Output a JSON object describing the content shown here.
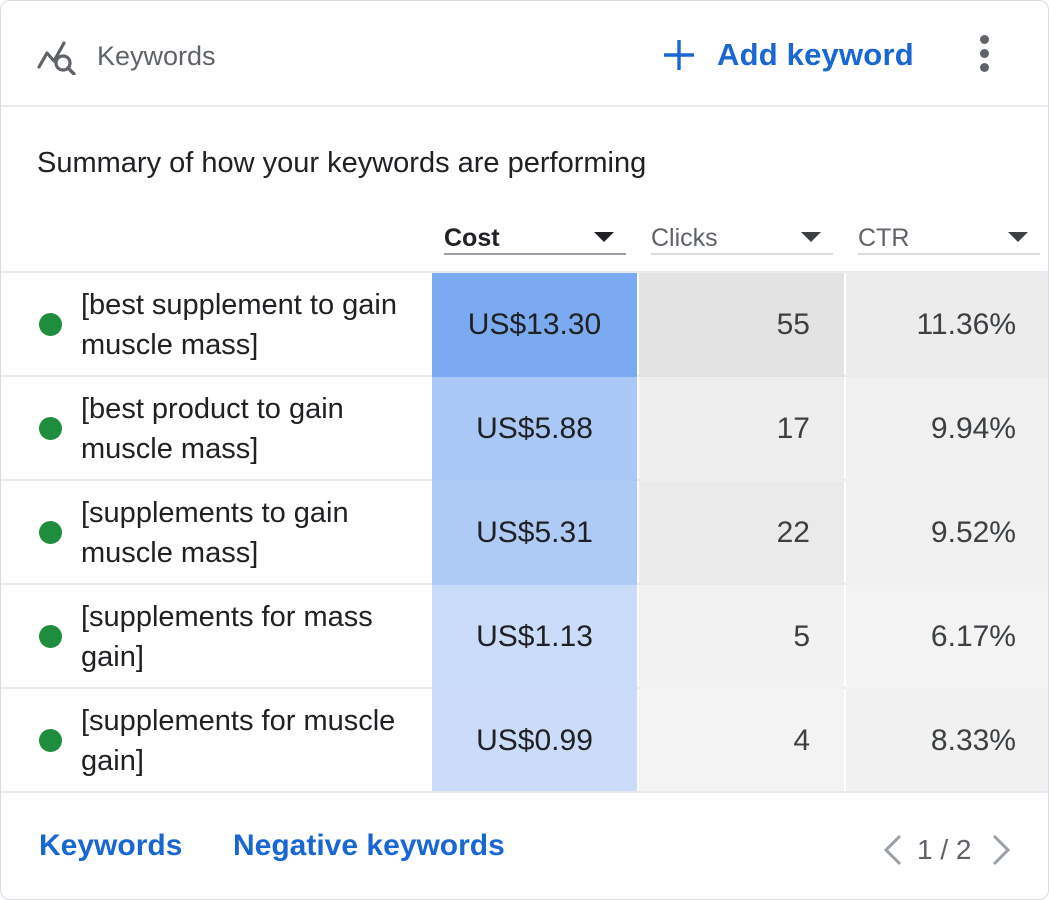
{
  "header": {
    "title": "Keywords",
    "add_label": "Add keyword",
    "icon": "keyword-search-icon"
  },
  "summary": "Summary of how your keywords are performing",
  "columns": [
    {
      "label": "Cost",
      "active": true
    },
    {
      "label": "Clicks",
      "active": false
    },
    {
      "label": "CTR",
      "active": false
    }
  ],
  "rows": [
    {
      "keyword": "[best supplement to gain muscle mass]",
      "status": "enabled",
      "cost": "US$13.30",
      "clicks": "55",
      "ctr": "11.36%"
    },
    {
      "keyword": "[best product to gain muscle mass]",
      "status": "enabled",
      "cost": "US$5.88",
      "clicks": "17",
      "ctr": "9.94%"
    },
    {
      "keyword": "[supplements to gain muscle mass]",
      "status": "enabled",
      "cost": "US$5.31",
      "clicks": "22",
      "ctr": "9.52%"
    },
    {
      "keyword": "[supplements for mass gain]",
      "status": "enabled",
      "cost": "US$1.13",
      "clicks": "5",
      "ctr": "6.17%"
    },
    {
      "keyword": "[supplements for muscle gain]",
      "status": "enabled",
      "cost": "US$0.99",
      "clicks": "4",
      "ctr": "8.33%"
    }
  ],
  "footer": {
    "link_keywords": "Keywords",
    "link_negative": "Negative keywords",
    "pager": "1 / 2"
  },
  "colors": {
    "accent": "#1967d2",
    "status_green": "#1e8e3e",
    "cost_heat": [
      "#7baaf0",
      "#a9c8f5",
      "#aecbf6",
      "#c9dcf9",
      "#cadcfa"
    ],
    "clicks_heat": [
      "#e3e3e3",
      "#eeeeee",
      "#eaeaea",
      "#f2f2f2",
      "#f3f3f3"
    ],
    "ctr_heat": [
      "#ececec",
      "#f0f0f0",
      "#f0f0f0",
      "#f3f3f3",
      "#f1f1f1"
    ]
  }
}
